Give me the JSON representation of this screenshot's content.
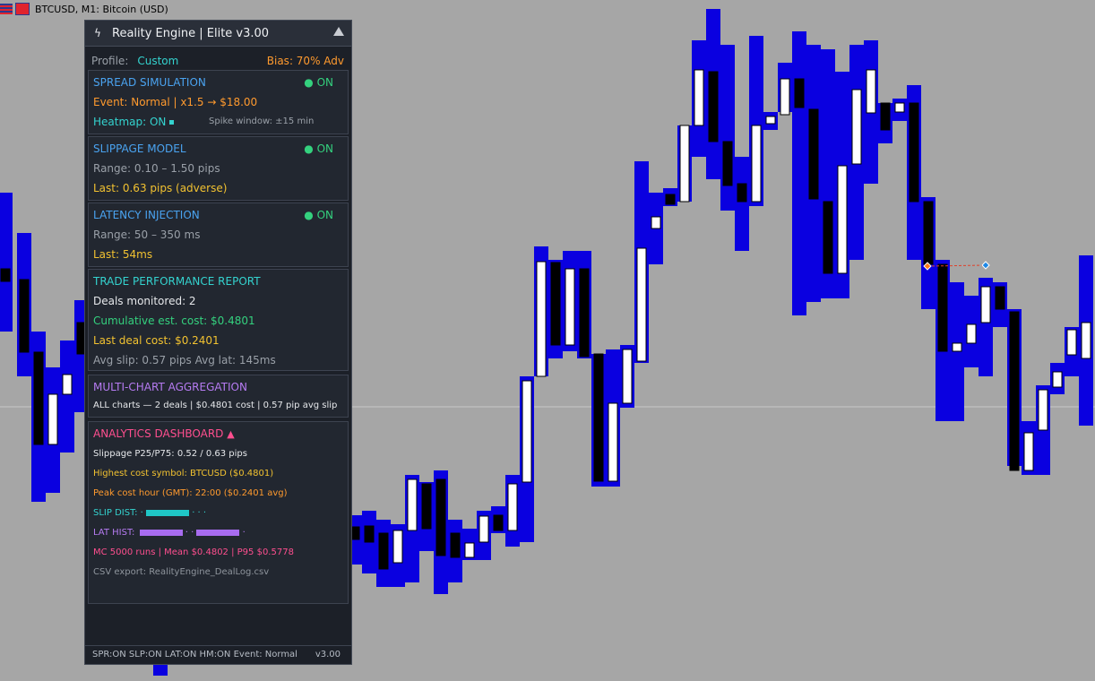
{
  "chart": {
    "title": "BTCUSD, M1:  Bitcoin (USD)",
    "up_color": "#ffffff",
    "down_color": "#000000",
    "spread_color": "#0a00e0"
  },
  "panel": {
    "title": "Reality Engine  |  Elite v3.00",
    "bolt_icon": "lightning-icon",
    "collapse_icon": "triangle-up-icon",
    "profile_label": "Profile:",
    "profile_value": "Custom",
    "bias": "Bias: 70% Adv",
    "spread": {
      "title": "SPREAD SIMULATION",
      "status": "● ON",
      "event": "Event: Normal  |  x1.5  →  $18.00",
      "heatmap": "Heatmap: ON",
      "spike": "Spike window: ±15 min"
    },
    "slippage": {
      "title": "SLIPPAGE MODEL",
      "status": "● ON",
      "range": "Range: 0.10 – 1.50 pips",
      "last": "Last: 0.63 pips (adverse)"
    },
    "latency": {
      "title": "LATENCY INJECTION",
      "status": "● ON",
      "range": "Range: 50 – 350 ms",
      "last": "Last: 54ms"
    },
    "report": {
      "title": "TRADE PERFORMANCE REPORT",
      "deals": "Deals monitored: 2",
      "cumulative": "Cumulative est. cost:  $0.4801",
      "last_deal": "Last deal cost:  $0.2401",
      "averages": "Avg slip: 0.57 pips   Avg lat: 145ms"
    },
    "multi": {
      "title": "MULTI-CHART AGGREGATION",
      "summary": "ALL charts — 2 deals | $0.4801 cost | 0.57 pip avg slip"
    },
    "analytics": {
      "title": "ANALYTICS DASHBOARD",
      "alert_icon": "triangle-alert-icon",
      "slippage_pct": "Slippage P25/P75: 0.52 / 0.63 pips",
      "highest": "Highest cost symbol: BTCUSD  ($0.4801)",
      "peak": "Peak cost hour (GMT): 22:00  ($0.2401 avg)",
      "slip_dist": "SLIP DIST:",
      "lat_hist": "LAT HIST:",
      "mc": "MC 5000 runs | Mean $0.4802 | P95 $0.5778",
      "csv": "CSV export: RealityEngine_DealLog.csv"
    },
    "footer": {
      "status": "SPR:ON   SLP:ON   LAT:ON   HM:ON   Event: Normal",
      "version": "v3.00"
    }
  },
  "colors": {
    "cyan": "#34d3cf",
    "orange": "#ff9a2e",
    "blue_title": "#4aa3f0",
    "green": "#34d17e",
    "gold": "#f2c230",
    "purple": "#b67bf2",
    "pink": "#ff4f8f",
    "gray": "#9aa0a8"
  }
}
